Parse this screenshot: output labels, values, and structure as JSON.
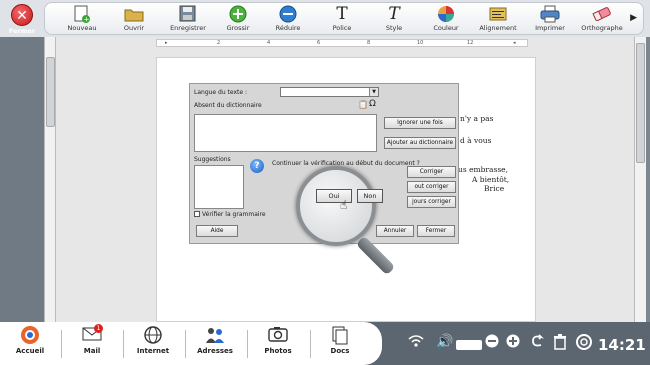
{
  "toolbar": {
    "close_label": "Fermer",
    "tools": [
      {
        "label": "Nouveau",
        "icon": "new-document-icon"
      },
      {
        "label": "Ouvrir",
        "icon": "folder-icon"
      },
      {
        "label": "Enregistrer",
        "icon": "save-icon"
      },
      {
        "label": "Grossir",
        "icon": "zoom-in-icon"
      },
      {
        "label": "Réduire",
        "icon": "zoom-out-icon"
      },
      {
        "label": "Police",
        "icon": "font-icon"
      },
      {
        "label": "Style",
        "icon": "italic-icon"
      },
      {
        "label": "Couleur",
        "icon": "color-icon"
      },
      {
        "label": "Alignement",
        "icon": "align-icon"
      },
      {
        "label": "Imprimer",
        "icon": "printer-icon"
      },
      {
        "label": "Orthographe",
        "icon": "eraser-icon"
      }
    ]
  },
  "document": {
    "lines": [
      "n'y a pas",
      "d à vous",
      "us embrasse,",
      "A bientôt,",
      "Brice"
    ]
  },
  "spell_dialog": {
    "language_label": "Langue du texte :",
    "absent_label": "Absent du dictionnaire",
    "suggestions_label": "Suggestions",
    "question": "Continuer la vérification au début du document ?",
    "check_grammar_label": "Vérifier la grammaire",
    "buttons": {
      "ignore_once": "Ignorer une fois",
      "add_dictionary": "Ajouter au dictionnaire",
      "correct": "Corriger",
      "correct_all": "out corriger",
      "always_correct": "jours corriger",
      "help": "Aide",
      "cancel": "Annuler",
      "close": "Fermer",
      "yes": "Oui",
      "no": "Non"
    }
  },
  "dock": {
    "items": [
      {
        "label": "Accueil",
        "icon": "home-icon"
      },
      {
        "label": "Mail",
        "icon": "mail-icon",
        "badge": "1"
      },
      {
        "label": "Internet",
        "icon": "globe-icon"
      },
      {
        "label": "Adresses",
        "icon": "contacts-icon"
      },
      {
        "label": "Photos",
        "icon": "camera-icon"
      },
      {
        "label": "Docs",
        "icon": "documents-icon"
      }
    ]
  },
  "system": {
    "clock": "14:21"
  }
}
